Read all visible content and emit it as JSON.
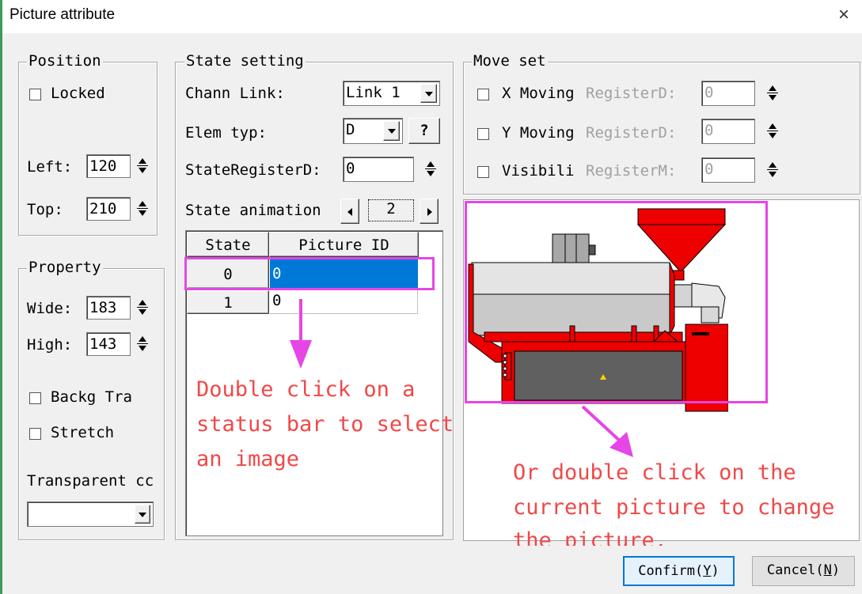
{
  "window": {
    "title": "Picture attribute",
    "close_glyph": "×"
  },
  "position": {
    "legend": "Position",
    "locked_label": "Locked",
    "left_label": "Left:",
    "left_value": "120",
    "top_label": "Top:",
    "top_value": "210"
  },
  "property": {
    "legend": "Property",
    "wide_label": "Wide:",
    "wide_value": "183",
    "high_label": "High:",
    "high_value": "143",
    "backg_label": "Backg Tra",
    "stretch_label": "Stretch",
    "transparent_label": "Transparent cc",
    "transparent_value": ""
  },
  "state_setting": {
    "legend": "State setting",
    "chann_label": "Chann Link:",
    "chann_value": "Link 1",
    "elem_label": "Elem typ:",
    "elem_value": "D",
    "help_label": "?",
    "state_reg_label": "StateRegisterD:",
    "state_reg_value": "0",
    "anim_label": "State animation",
    "anim_value": "2",
    "table": {
      "headers": [
        "State",
        "Picture ID"
      ],
      "rows": [
        {
          "state": "0",
          "picture_id": "0"
        },
        {
          "state": "1",
          "picture_id": "0"
        }
      ]
    }
  },
  "move_set": {
    "legend": "Move set",
    "x_label": "X Moving",
    "x_reg": "RegisterD:",
    "x_value": "0",
    "y_label": "Y Moving",
    "y_reg": "RegisterD:",
    "y_value": "0",
    "vis_label": "Visibili",
    "vis_reg": "RegisterM:",
    "vis_value": "0"
  },
  "annotations": {
    "left_line1": "Double click on a",
    "left_line2": "status bar to select",
    "left_line3": "an image",
    "right_line1": "Or double click on the",
    "right_line2": "current picture to change",
    "right_line3": "the picture."
  },
  "buttons": {
    "confirm_text": "Confirm(",
    "confirm_key": "Y",
    "cancel_text": "Cancel(",
    "cancel_key": "N",
    "close_paren": ")"
  },
  "colors": {
    "annotation_red": "#f04848",
    "highlight_magenta": "#e546e5",
    "selection_blue": "#0078d7",
    "machine_red": "#ee0000"
  },
  "icons": [
    "close-icon",
    "dropdown-arrow-icon",
    "spin-up-icon",
    "spin-down-icon",
    "scroll-left-icon",
    "scroll-right-icon",
    "annotation-arrow-icon",
    "machine-picture"
  ]
}
